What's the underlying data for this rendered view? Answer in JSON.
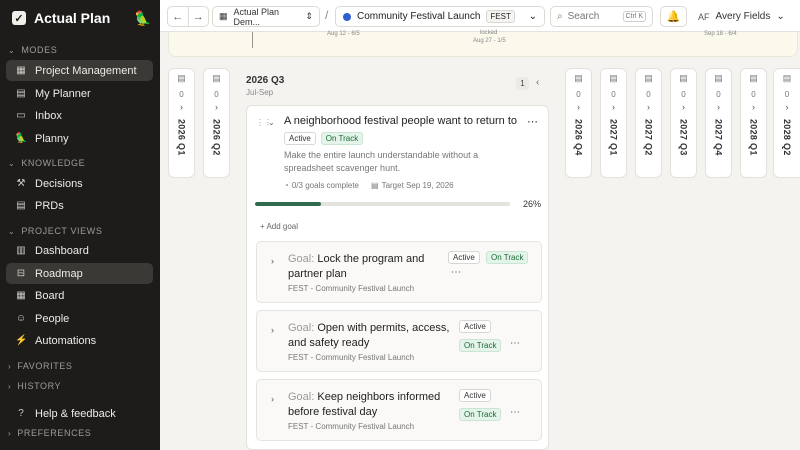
{
  "app": {
    "name": "Actual Plan",
    "logo_glyph": "✓"
  },
  "sidebar": {
    "sections": {
      "modes": "MODES",
      "knowledge": "KNOWLEDGE",
      "project_views": "PROJECT VIEWS",
      "favorites": "FAVORITES",
      "history": "HISTORY",
      "preferences": "PREFERENCES"
    },
    "items": {
      "project_management": "Project Management",
      "my_planner": "My Planner",
      "inbox": "Inbox",
      "planny": "Planny",
      "decisions": "Decisions",
      "prds": "PRDs",
      "dashboard": "Dashboard",
      "roadmap": "Roadmap",
      "board": "Board",
      "people": "People",
      "automations": "Automations",
      "help": "Help & feedback"
    }
  },
  "topbar": {
    "workspace": "Actual Plan Dem...",
    "separator": "/",
    "project": "Community Festival Launch",
    "project_tag": "FEST",
    "search_label": "Search",
    "search_shortcut": "Ctrl K",
    "user_initials": "AF",
    "user_name": "Avery Fields"
  },
  "banner": {
    "left_date": "Aug 12 - 6/5",
    "center_label": "locked",
    "center_date": "Aug 27 - 1/5",
    "right_date": "Sep 18 - 6/4"
  },
  "quarters_left": [
    {
      "count": "0",
      "label": "2026 Q1"
    },
    {
      "count": "0",
      "label": "2026 Q2"
    }
  ],
  "quarters_right": [
    {
      "count": "0",
      "label": "2026 Q4"
    },
    {
      "count": "0",
      "label": "2027 Q1"
    },
    {
      "count": "0",
      "label": "2027 Q2"
    },
    {
      "count": "0",
      "label": "2027 Q3"
    },
    {
      "count": "0",
      "label": "2027 Q4"
    },
    {
      "count": "0",
      "label": "2028 Q1"
    },
    {
      "count": "0",
      "label": "2028 Q2"
    }
  ],
  "expanded": {
    "title": "2026 Q3",
    "subtitle": "Jul-Sep",
    "count": "1"
  },
  "objective": {
    "title": "A neighborhood festival people want to return to",
    "status": "Active",
    "health": "On Track",
    "description": "Make the entire launch understandable without a spreadsheet scavenger hunt.",
    "goals_complete": "0/3 goals complete",
    "target": "Target Sep 19, 2026",
    "progress": 0.26,
    "progress_label": "26%",
    "add_goal": "Add goal",
    "accent": "#2f6b4c"
  },
  "goals": [
    {
      "prefix": "Goal:",
      "title": "Lock the program and partner plan",
      "status": "Active",
      "health": "On Track",
      "project": "FEST - Community Festival Launch"
    },
    {
      "prefix": "Goal:",
      "title": "Open with permits, access, and safety ready",
      "status": "Active",
      "health": "On Track",
      "project": "FEST - Community Festival Launch"
    },
    {
      "prefix": "Goal:",
      "title": "Keep neighbors informed before festival day",
      "status": "Active",
      "health": "On Track",
      "project": "FEST - Community Festival Launch"
    }
  ]
}
